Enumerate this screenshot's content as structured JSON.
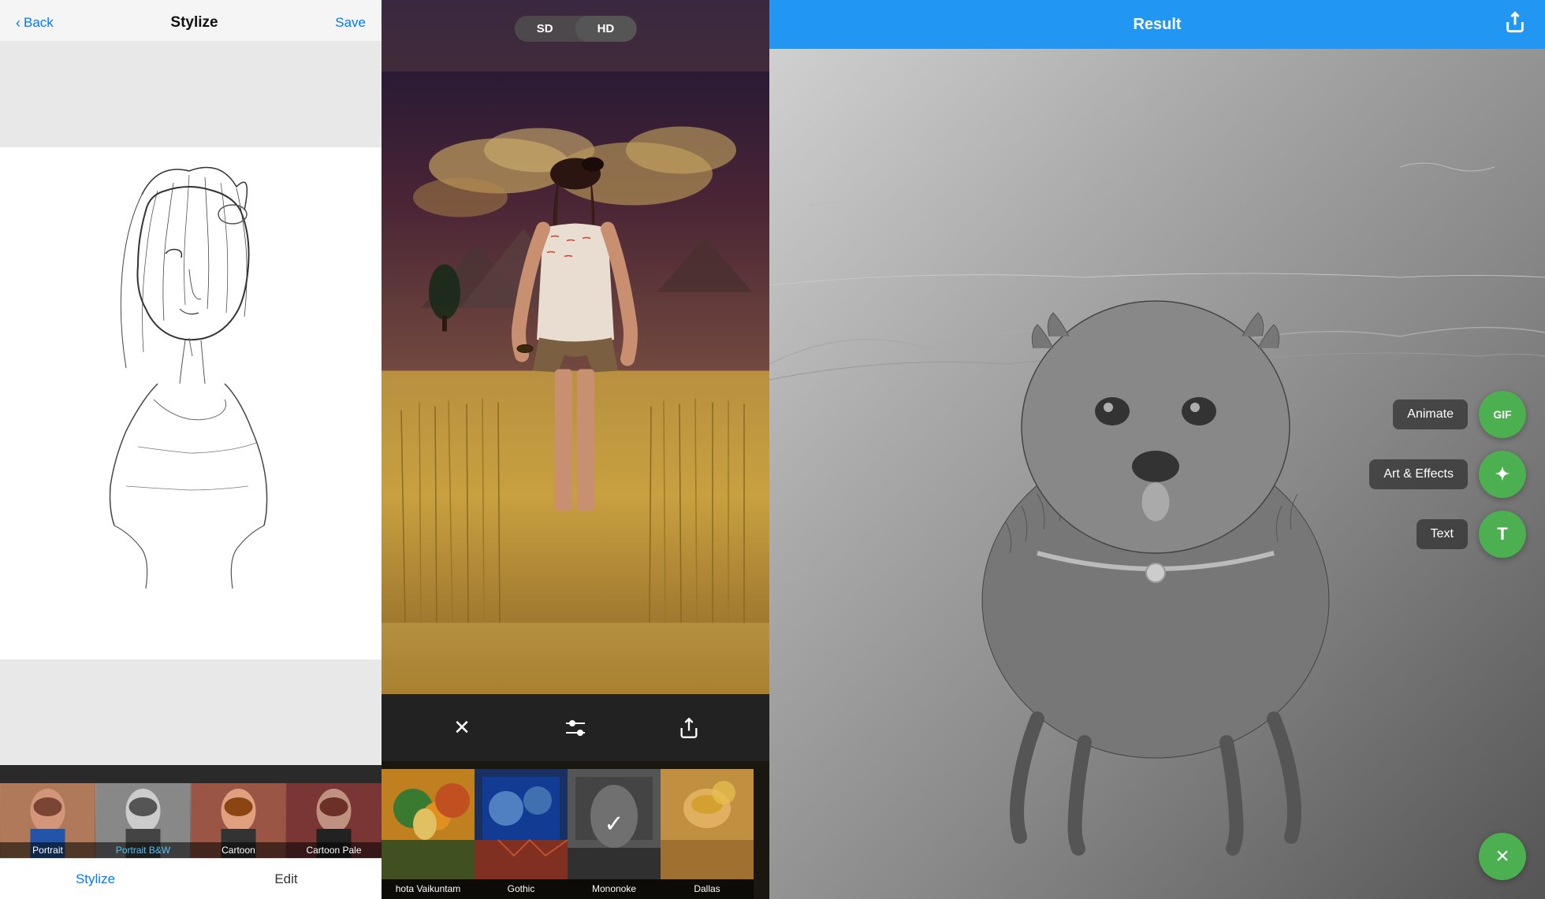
{
  "panel1": {
    "header": {
      "back_label": "Back",
      "title": "Stylize",
      "save_label": "Save"
    },
    "filters": [
      {
        "id": "portrait",
        "label": "Portrait",
        "active": false
      },
      {
        "id": "portrait-bw",
        "label": "Portrait B&W",
        "active": false
      },
      {
        "id": "cartoon",
        "label": "Cartoon",
        "active": false
      },
      {
        "id": "cartoon-pale",
        "label": "Cartoon Pale",
        "active": false
      }
    ],
    "tabs": [
      {
        "id": "stylize",
        "label": "Stylize",
        "active": true
      },
      {
        "id": "edit",
        "label": "Edit",
        "active": false
      }
    ]
  },
  "panel2": {
    "quality": {
      "sd_label": "SD",
      "hd_label": "HD",
      "active": "hd"
    },
    "gallery": [
      {
        "id": "vaikuntam",
        "label": "hota Vaikuntam",
        "selected": false
      },
      {
        "id": "gothic",
        "label": "Gothic",
        "selected": false
      },
      {
        "id": "mononoke",
        "label": "Mononoke",
        "selected": true
      },
      {
        "id": "dallas",
        "label": "Dallas",
        "selected": false
      }
    ]
  },
  "panel3": {
    "header": {
      "title": "Result"
    },
    "actions": [
      {
        "id": "animate",
        "label": "Animate",
        "icon": "GIF"
      },
      {
        "id": "art-effects",
        "label": "Art & Effects",
        "icon": "✦"
      },
      {
        "id": "text",
        "label": "Text",
        "icon": "T"
      }
    ],
    "close_icon": "×"
  }
}
